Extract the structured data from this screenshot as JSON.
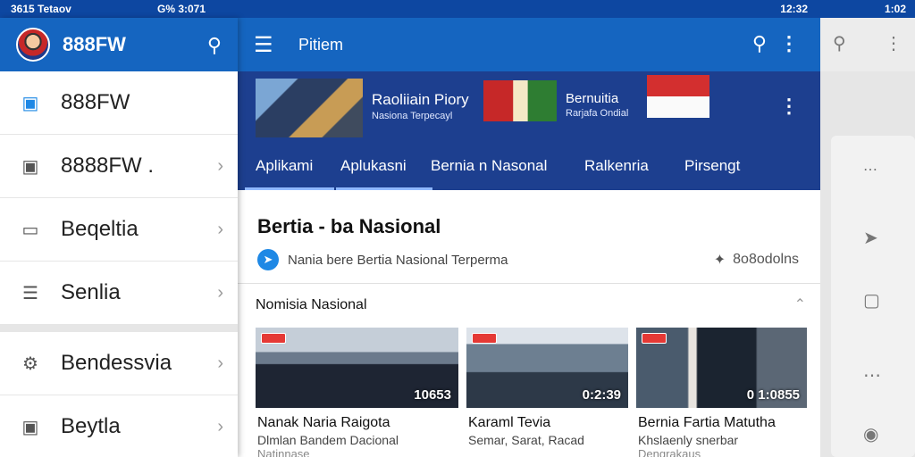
{
  "status_bar": {
    "left_text": "3615 Tetaov",
    "mid_text": "G% 3:071",
    "right_time": "12:32",
    "far_time": "1:02"
  },
  "drawer": {
    "title": "888FW",
    "items": [
      {
        "label": "888FW",
        "icon": "app-icon",
        "chevron": false
      },
      {
        "label": "8888FW .",
        "icon": "image-icon",
        "chevron": true
      },
      {
        "label": "Beqeltia",
        "icon": "monitor-icon",
        "chevron": true
      },
      {
        "label": "Senlia",
        "icon": "list-icon",
        "chevron": true
      },
      {
        "label": "Bendessvia",
        "icon": "gear-icon",
        "chevron": true
      },
      {
        "label": "Beytla",
        "icon": "square-icon",
        "chevron": true
      }
    ]
  },
  "appbar": {
    "title": "Pitiem"
  },
  "banner": {
    "item1_title": "Raoliiain Piory",
    "item1_subtitle": "Nasiona Terpecayl",
    "item2_title": "Bernuitia",
    "item2_subtitle": "Rarjafa Ondial"
  },
  "tabs": [
    "Aplikami",
    "Aplukasni",
    "Bernia n Nasonal",
    "Ralkenria",
    "Pirsengt"
  ],
  "content": {
    "section_title": "Bertia - ba Nasional",
    "info_text": "Nania bere Bertia Nasional Terperma",
    "info_count": "8o8odolns",
    "sub_title": "Nomisia Nasional",
    "cards": [
      {
        "count": "10653",
        "title": "Nanak Naria Raigota",
        "subtitle": "Dlmlan Bandem Dacional",
        "subtitle2": "Natinnase"
      },
      {
        "count": "0:2:39",
        "title": "Karaml Tevia",
        "subtitle": "Semar, Sarat, Racad",
        "subtitle2": ""
      },
      {
        "count": "0 1:0855",
        "title": "Bernia Fartia Matutha",
        "subtitle": "Khslaenly snerbar",
        "subtitle2": "Dengrakaus"
      }
    ]
  },
  "colors": {
    "primary": "#1565c0",
    "banner": "#1d3f8f",
    "accent": "#1e88e5"
  }
}
